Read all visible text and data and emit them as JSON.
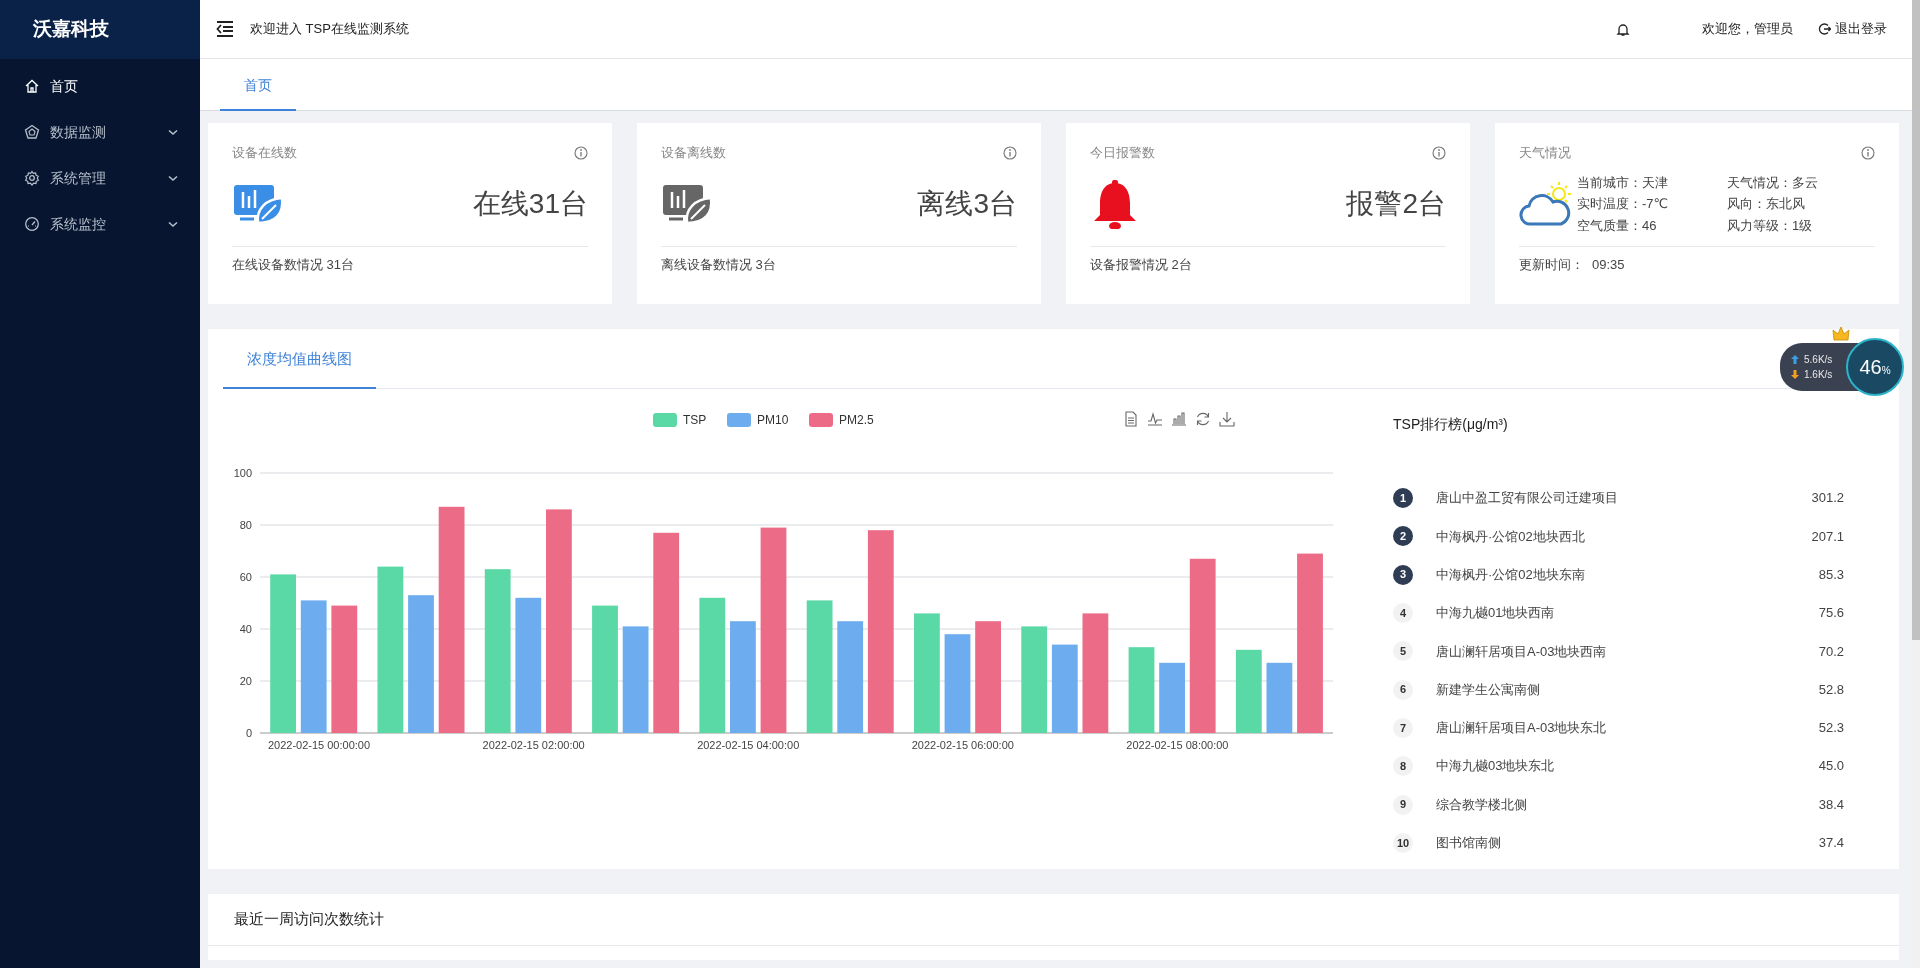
{
  "sidebar": {
    "brand": "沃嘉科技",
    "items": [
      {
        "label": "首页",
        "selected": true,
        "expandable": false
      },
      {
        "label": "数据监测",
        "selected": false,
        "expandable": true
      },
      {
        "label": "系统管理",
        "selected": false,
        "expandable": true
      },
      {
        "label": "系统监控",
        "selected": false,
        "expandable": true
      }
    ]
  },
  "header": {
    "title": "欢迎进入 TSP在线监测系统",
    "user": "欢迎您，管理员",
    "logout": "退出登录"
  },
  "tabs": [
    {
      "label": "首页",
      "selected": true
    }
  ],
  "stat_cards": [
    {
      "kind": "online",
      "title": "设备在线数",
      "value": "在线31台",
      "footer": "在线设备数情况 31台"
    },
    {
      "kind": "offline",
      "title": "设备离线数",
      "value": "离线3台",
      "footer": "离线设备数情况 3台"
    },
    {
      "kind": "alarm",
      "title": "今日报警数",
      "value": "报警2台",
      "footer": "设备报警情况 2台"
    }
  ],
  "weather": {
    "title": "天气情况",
    "fields": [
      "当前城市：天津",
      "天气情况：多云",
      "实时温度：-7℃",
      "风向：东北风",
      "空气质量：46",
      "风力等级：1级"
    ],
    "updated_label": "更新时间：",
    "updated_time": "09:35"
  },
  "chart_panel": {
    "tabs": [
      {
        "label": "浓度均值曲线图",
        "selected": true
      }
    ],
    "chart_data": {
      "type": "bar",
      "ylim": [
        0,
        100
      ],
      "yticks": [
        0,
        20,
        40,
        60,
        80,
        100
      ],
      "grid": true,
      "legend": true,
      "categories": [
        "2022-02-15 00:00:00",
        null,
        "2022-02-15 02:00:00",
        null,
        "2022-02-15 04:00:00",
        null,
        "2022-02-15 06:00:00",
        null,
        "2022-02-15 08:00:00",
        null
      ],
      "series": [
        {
          "name": "TSP",
          "color": "#5ad8a6",
          "values": [
            61,
            64,
            63,
            49,
            52,
            51,
            46,
            41,
            33,
            32
          ]
        },
        {
          "name": "PM10",
          "color": "#6dadef",
          "values": [
            51,
            53,
            52,
            41,
            43,
            43,
            38,
            34,
            27,
            27
          ]
        },
        {
          "name": "PM2.5",
          "color": "#ec6b86",
          "values": [
            49,
            87,
            86,
            77,
            79,
            78,
            43,
            46,
            67,
            69
          ]
        }
      ]
    },
    "ranking": {
      "title": "TSP排行榜(μg/m³)",
      "items": [
        {
          "rank": "1",
          "name": "唐山中盈工贸有限公司迁建项目",
          "value": "301.2",
          "highlighted": true
        },
        {
          "rank": "2",
          "name": "中海枫丹·公馆02地块西北",
          "value": "207.1",
          "highlighted": true
        },
        {
          "rank": "3",
          "name": "中海枫丹·公馆02地块东南",
          "value": "85.3",
          "highlighted": true
        },
        {
          "rank": "4",
          "name": "中海九樾01地块西南",
          "value": "75.6",
          "highlighted": false
        },
        {
          "rank": "5",
          "name": "唐山澜轩居项目A-03地块西南",
          "value": "70.2",
          "highlighted": false
        },
        {
          "rank": "6",
          "name": "新建学生公寓南侧",
          "value": "52.8",
          "highlighted": false
        },
        {
          "rank": "7",
          "name": "唐山澜轩居项目A-03地块东北",
          "value": "52.3",
          "highlighted": false
        },
        {
          "rank": "8",
          "name": "中海九樾03地块东北",
          "value": "45.0",
          "highlighted": false
        },
        {
          "rank": "9",
          "name": "综合教学楼北侧",
          "value": "38.4",
          "highlighted": false
        },
        {
          "rank": "10",
          "name": "图书馆南侧",
          "value": "37.4",
          "highlighted": false
        }
      ]
    }
  },
  "bottom_panel": {
    "title": "最近一周访问次数统计"
  },
  "speed_widget": {
    "upload": "5.6K/s",
    "download": "1.6K/s",
    "percent": "46",
    "percent_unit": "%"
  }
}
